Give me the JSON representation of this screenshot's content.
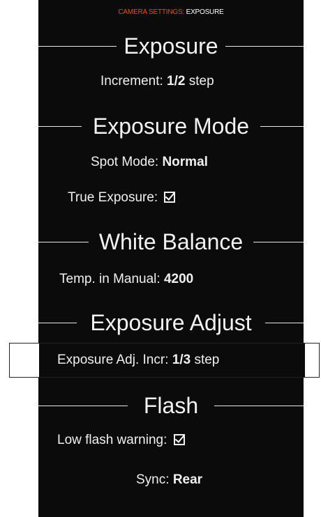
{
  "header": {
    "category": "CAMERA SETTINGS:",
    "page": "EXPOSURE"
  },
  "sections": {
    "exposure": {
      "title": "Exposure",
      "increment_label": "Increment:",
      "increment_value": "1/2",
      "increment_unit": "step"
    },
    "exposure_mode": {
      "title": "Exposure Mode",
      "spot_mode_label": "Spot Mode:",
      "spot_mode_value": "Normal",
      "true_exposure_label": "True Exposure:",
      "true_exposure_checked": true
    },
    "white_balance": {
      "title": "White Balance",
      "temp_label": "Temp. in Manual:",
      "temp_value": "4200"
    },
    "exposure_adjust": {
      "title": "Exposure Adjust",
      "incr_label": "Exposure Adj. Incr:",
      "incr_value": "1/3",
      "incr_unit": "step"
    },
    "flash": {
      "title": "Flash",
      "low_warning_label": "Low flash warning:",
      "low_warning_checked": true,
      "sync_label": "Sync:",
      "sync_value": "Rear"
    }
  },
  "colors": {
    "background": "#0b0b0b",
    "text": "#f0f0f0",
    "category_accent": "#e0501a"
  }
}
